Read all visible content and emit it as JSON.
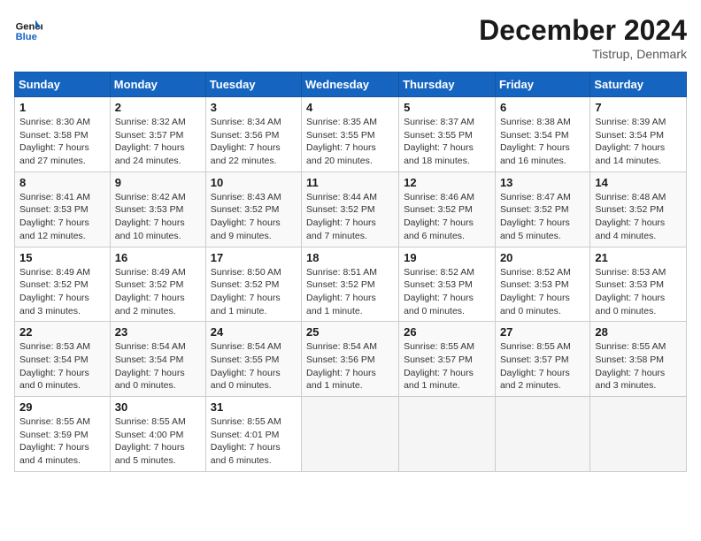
{
  "header": {
    "logo_line1": "General",
    "logo_line2": "Blue",
    "month": "December 2024",
    "location": "Tistrup, Denmark"
  },
  "weekdays": [
    "Sunday",
    "Monday",
    "Tuesday",
    "Wednesday",
    "Thursday",
    "Friday",
    "Saturday"
  ],
  "weeks": [
    [
      {
        "day": "1",
        "sunrise": "8:30 AM",
        "sunset": "3:58 PM",
        "daylight": "7 hours and 27 minutes."
      },
      {
        "day": "2",
        "sunrise": "8:32 AM",
        "sunset": "3:57 PM",
        "daylight": "7 hours and 24 minutes."
      },
      {
        "day": "3",
        "sunrise": "8:34 AM",
        "sunset": "3:56 PM",
        "daylight": "7 hours and 22 minutes."
      },
      {
        "day": "4",
        "sunrise": "8:35 AM",
        "sunset": "3:55 PM",
        "daylight": "7 hours and 20 minutes."
      },
      {
        "day": "5",
        "sunrise": "8:37 AM",
        "sunset": "3:55 PM",
        "daylight": "7 hours and 18 minutes."
      },
      {
        "day": "6",
        "sunrise": "8:38 AM",
        "sunset": "3:54 PM",
        "daylight": "7 hours and 16 minutes."
      },
      {
        "day": "7",
        "sunrise": "8:39 AM",
        "sunset": "3:54 PM",
        "daylight": "7 hours and 14 minutes."
      }
    ],
    [
      {
        "day": "8",
        "sunrise": "8:41 AM",
        "sunset": "3:53 PM",
        "daylight": "7 hours and 12 minutes."
      },
      {
        "day": "9",
        "sunrise": "8:42 AM",
        "sunset": "3:53 PM",
        "daylight": "7 hours and 10 minutes."
      },
      {
        "day": "10",
        "sunrise": "8:43 AM",
        "sunset": "3:52 PM",
        "daylight": "7 hours and 9 minutes."
      },
      {
        "day": "11",
        "sunrise": "8:44 AM",
        "sunset": "3:52 PM",
        "daylight": "7 hours and 7 minutes."
      },
      {
        "day": "12",
        "sunrise": "8:46 AM",
        "sunset": "3:52 PM",
        "daylight": "7 hours and 6 minutes."
      },
      {
        "day": "13",
        "sunrise": "8:47 AM",
        "sunset": "3:52 PM",
        "daylight": "7 hours and 5 minutes."
      },
      {
        "day": "14",
        "sunrise": "8:48 AM",
        "sunset": "3:52 PM",
        "daylight": "7 hours and 4 minutes."
      }
    ],
    [
      {
        "day": "15",
        "sunrise": "8:49 AM",
        "sunset": "3:52 PM",
        "daylight": "7 hours and 3 minutes."
      },
      {
        "day": "16",
        "sunrise": "8:49 AM",
        "sunset": "3:52 PM",
        "daylight": "7 hours and 2 minutes."
      },
      {
        "day": "17",
        "sunrise": "8:50 AM",
        "sunset": "3:52 PM",
        "daylight": "7 hours and 1 minute."
      },
      {
        "day": "18",
        "sunrise": "8:51 AM",
        "sunset": "3:52 PM",
        "daylight": "7 hours and 1 minute."
      },
      {
        "day": "19",
        "sunrise": "8:52 AM",
        "sunset": "3:53 PM",
        "daylight": "7 hours and 0 minutes."
      },
      {
        "day": "20",
        "sunrise": "8:52 AM",
        "sunset": "3:53 PM",
        "daylight": "7 hours and 0 minutes."
      },
      {
        "day": "21",
        "sunrise": "8:53 AM",
        "sunset": "3:53 PM",
        "daylight": "7 hours and 0 minutes."
      }
    ],
    [
      {
        "day": "22",
        "sunrise": "8:53 AM",
        "sunset": "3:54 PM",
        "daylight": "7 hours and 0 minutes."
      },
      {
        "day": "23",
        "sunrise": "8:54 AM",
        "sunset": "3:54 PM",
        "daylight": "7 hours and 0 minutes."
      },
      {
        "day": "24",
        "sunrise": "8:54 AM",
        "sunset": "3:55 PM",
        "daylight": "7 hours and 0 minutes."
      },
      {
        "day": "25",
        "sunrise": "8:54 AM",
        "sunset": "3:56 PM",
        "daylight": "7 hours and 1 minute."
      },
      {
        "day": "26",
        "sunrise": "8:55 AM",
        "sunset": "3:57 PM",
        "daylight": "7 hours and 1 minute."
      },
      {
        "day": "27",
        "sunrise": "8:55 AM",
        "sunset": "3:57 PM",
        "daylight": "7 hours and 2 minutes."
      },
      {
        "day": "28",
        "sunrise": "8:55 AM",
        "sunset": "3:58 PM",
        "daylight": "7 hours and 3 minutes."
      }
    ],
    [
      {
        "day": "29",
        "sunrise": "8:55 AM",
        "sunset": "3:59 PM",
        "daylight": "7 hours and 4 minutes."
      },
      {
        "day": "30",
        "sunrise": "8:55 AM",
        "sunset": "4:00 PM",
        "daylight": "7 hours and 5 minutes."
      },
      {
        "day": "31",
        "sunrise": "8:55 AM",
        "sunset": "4:01 PM",
        "daylight": "7 hours and 6 minutes."
      },
      null,
      null,
      null,
      null
    ]
  ]
}
